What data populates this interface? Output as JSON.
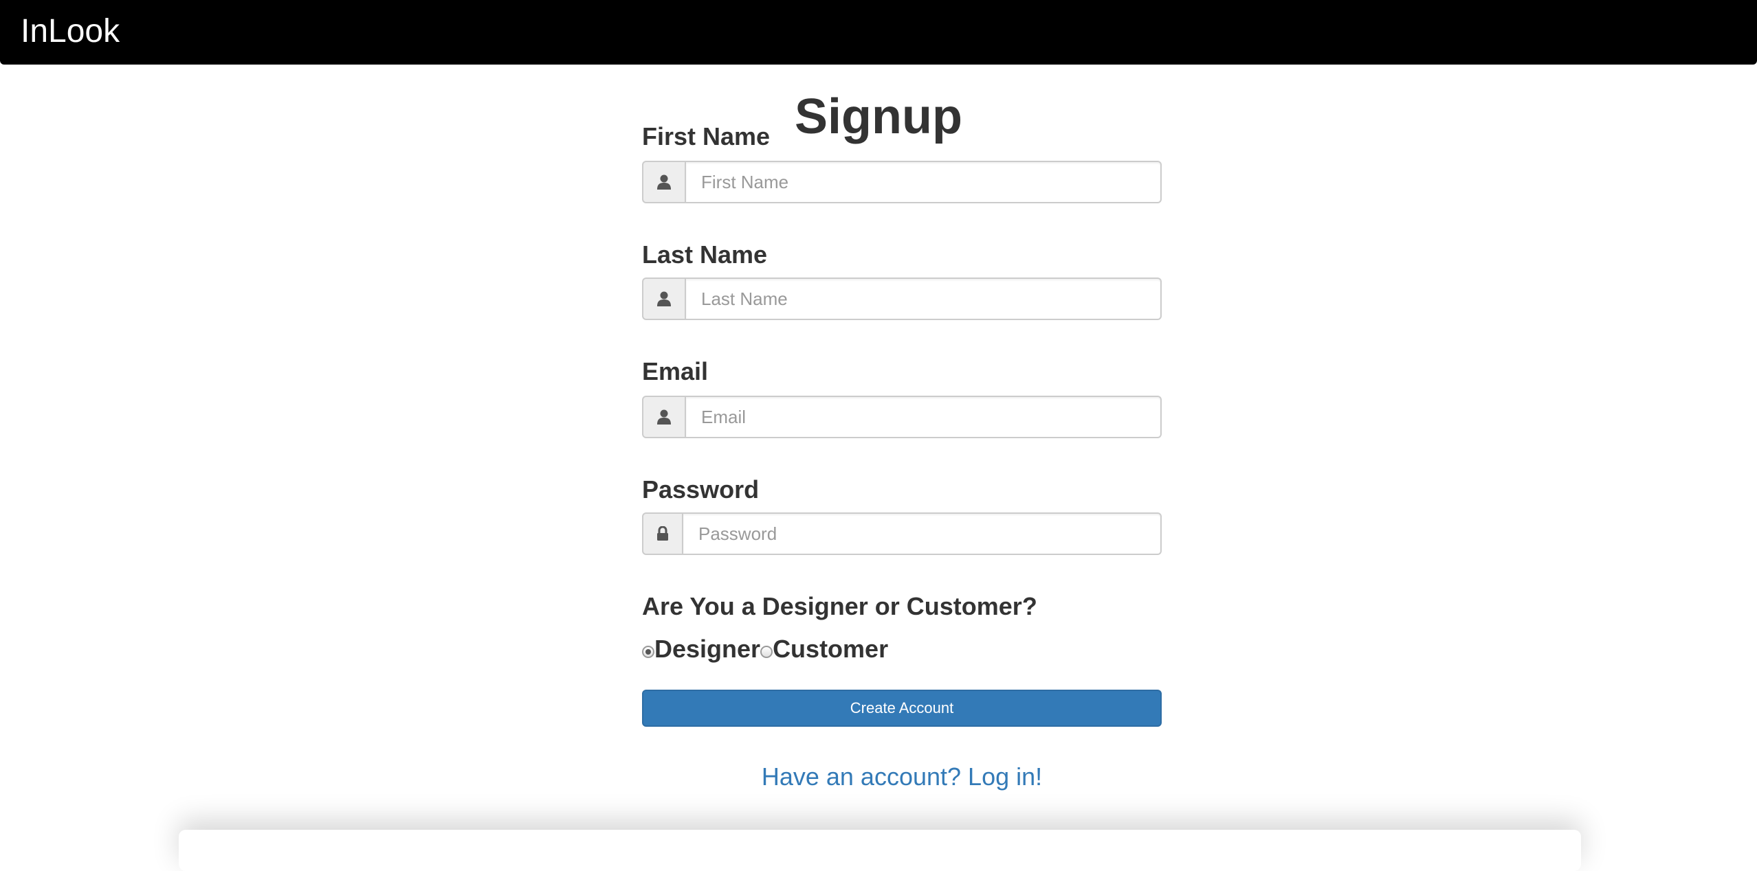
{
  "navbar": {
    "brand": "InLook"
  },
  "page": {
    "title": "Signup"
  },
  "form": {
    "first_name": {
      "label": "First Name",
      "placeholder": "First Name",
      "value": "",
      "icon": "user-icon"
    },
    "last_name": {
      "label": "Last Name",
      "placeholder": "Last Name",
      "value": "",
      "icon": "user-icon"
    },
    "email": {
      "label": "Email",
      "placeholder": "Email",
      "value": "",
      "icon": "user-icon"
    },
    "password": {
      "label": "Password",
      "placeholder": "Password",
      "value": "",
      "icon": "lock-icon"
    },
    "role": {
      "question": "Are You a Designer or Customer?",
      "options": [
        {
          "label": "Designer",
          "checked": true
        },
        {
          "label": "Customer",
          "checked": false
        }
      ]
    },
    "submit_label": "Create Account",
    "login_link": "Have an account? Log in!"
  },
  "colors": {
    "navbar_bg": "#000000",
    "primary": "#337ab7",
    "text": "#333333"
  }
}
